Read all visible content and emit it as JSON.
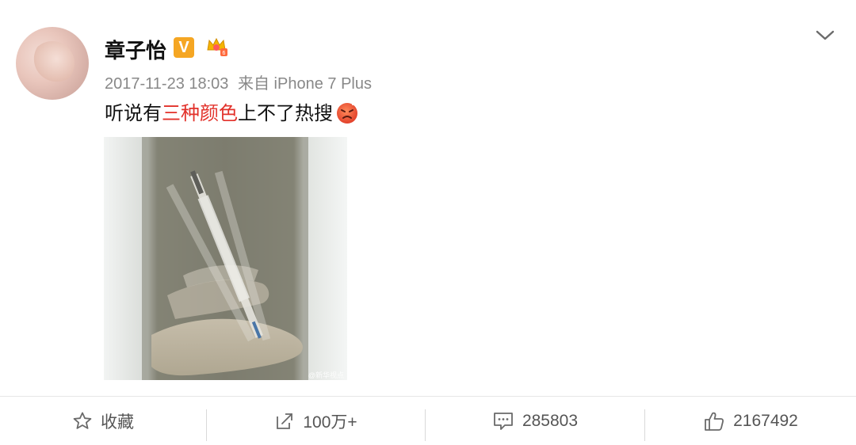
{
  "post": {
    "username": "章子怡",
    "verified_badge": "V",
    "timestamp": "2017-11-23 18:03",
    "source": "来自 iPhone 7 Plus",
    "content": {
      "before": "听说有",
      "highlight": "三种颜色",
      "after": "上不了热搜",
      "emoji": "angry-emoji-icon",
      "highlight_color": "#e2312a"
    },
    "image_watermark": "@新华视点"
  },
  "actions": {
    "favorite_label": "收藏",
    "repost_count": "100万+",
    "comment_count": "285803",
    "like_count": "2167492"
  },
  "colors": {
    "badge": "#f5a623",
    "text": "#111111",
    "meta": "#888888"
  }
}
